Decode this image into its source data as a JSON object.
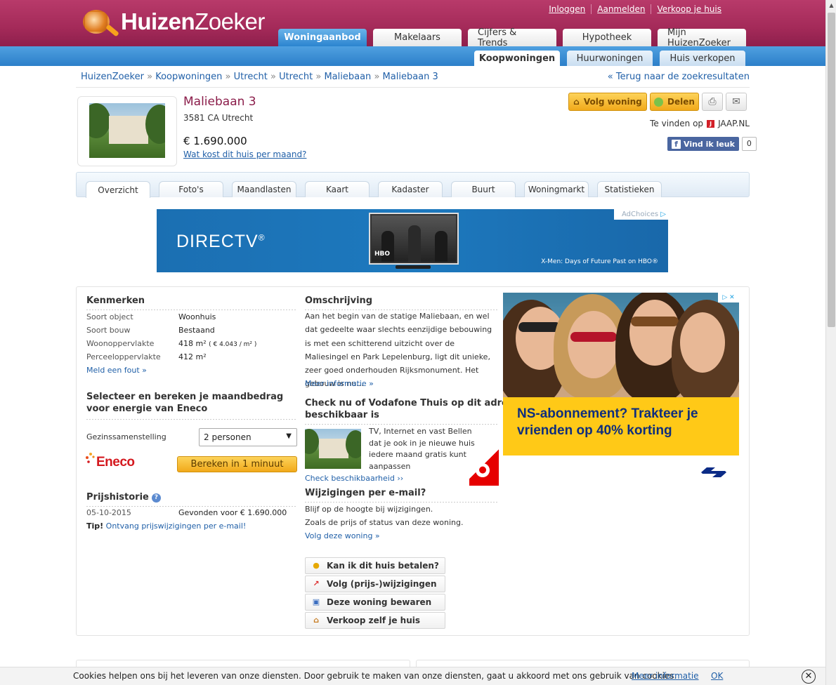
{
  "header": {
    "logo_bold": "Huizen",
    "logo_light": "Zoeker",
    "top_links": [
      "Inloggen",
      "Aanmelden",
      "Verkoop je huis"
    ],
    "main_tabs": [
      "Woningaanbod",
      "Makelaars",
      "Cijfers & Trends",
      "Hypotheek",
      "Mijn HuizenZoeker"
    ],
    "active_main_tab": "Woningaanbod",
    "sub_tabs": [
      "Koopwoningen",
      "Huurwoningen",
      "Huis verkopen"
    ],
    "active_sub_tab": "Koopwoningen"
  },
  "breadcrumb": [
    "HuizenZoeker",
    "Koopwoningen",
    "Utrecht",
    "Utrecht",
    "Maliebaan",
    "Maliebaan 3"
  ],
  "breadcrumb_sep": "»",
  "back_link": "« Terug naar de zoekresultaten",
  "listing": {
    "title": "Maliebaan 3",
    "address": "3581 CA Utrecht",
    "price": "€ 1.690.000",
    "monthly_link": "Wat kost dit huis per maand?",
    "follow_button": "Volg woning",
    "share_button": "Delen",
    "found_on_label": "Te vinden op",
    "found_on_site": "JAAP.NL",
    "fb_like": "Vind ik leuk",
    "fb_count": "0"
  },
  "property_tabs": [
    "Overzicht",
    "Foto's",
    "Maandlasten",
    "Kaart",
    "Kadaster",
    "Buurt",
    "Woningmarkt",
    "Statistieken"
  ],
  "active_property_tab": "Overzicht",
  "ad_top": {
    "brand": "DIRECTV",
    "reg": "®",
    "tv_logo": "HBO",
    "caption": "X-Men: Days of Future Past on HBO®",
    "adchoices": "AdChoices"
  },
  "kenmerken": {
    "heading": "Kenmerken",
    "rows": [
      {
        "label": "Soort object",
        "value": "Woonhuis"
      },
      {
        "label": "Soort bouw",
        "value": "Bestaand"
      },
      {
        "label": "Woonoppervlakte",
        "value": "418 m²",
        "extra": "( € 4.043 / m² )"
      },
      {
        "label": "Perceeloppervlakte",
        "value": "412 m²"
      }
    ],
    "error_link": "Meld een fout »"
  },
  "energy": {
    "heading_line1": "Selecteer en bereken je maandbedrag",
    "heading_line2": "voor energie van Eneco",
    "field_label": "Gezinssamenstelling",
    "field_value": "2 personen",
    "brand": "Eneco",
    "button": "Bereken in 1 minuut"
  },
  "price_history": {
    "heading": "Prijshistorie",
    "date": "05-10-2015",
    "event": "Gevonden voor € 1.690.000",
    "tip_label": "Tip!",
    "tip_link": "Ontvang prijswijzigingen per e-mail!"
  },
  "description": {
    "heading": "Omschrijving",
    "text": "Aan het begin van de statige Maliebaan, en wel dat gedeelte waar slechts eenzijdige bebouwing is met een schitterend uitzicht over de Maliesingel en Park Lepelenburg, ligt dit unieke, zeer goed onderhouden Rijksmonument. Het gebouw is nu...",
    "more_link": "Meer informatie »"
  },
  "vodafone": {
    "heading_line1": "Check nu of Vodafone Thuis op dit adres",
    "heading_line2": "beschikbaar is",
    "text": "TV, Internet en vast Bellen dat je ook in je nieuwe huis iedere maand gratis kunt aanpassen",
    "link": "Check beschikbaarheid ››"
  },
  "email_changes": {
    "heading": "Wijzigingen per e-mail?",
    "line1": "Blijf op de hoogte bij wijzigingen.",
    "line2": "Zoals de prijs of status van deze woning.",
    "link": "Volg deze woning »"
  },
  "actions": [
    "Kan ik dit huis betalen?",
    "Volg (prijs-)wijzigingen",
    "Deze woning bewaren",
    "Verkoop zelf je huis"
  ],
  "ad_side": {
    "line1": "NS-abonnement? Trakteer je",
    "line2": "vrienden op 40% korting"
  },
  "cookie": {
    "message": "Cookies helpen ons bij het leveren van onze diensten. Door gebruik te maken van onze diensten, gaat u akkoord met ons gebruik van cookies.",
    "more": "Meer informatie",
    "ok": "OK",
    "close": "✕"
  },
  "colors": {
    "brand": "#a42a59",
    "blue": "#2c7fc9",
    "link": "#2160a8",
    "button_yellow": "#f1a91a"
  }
}
